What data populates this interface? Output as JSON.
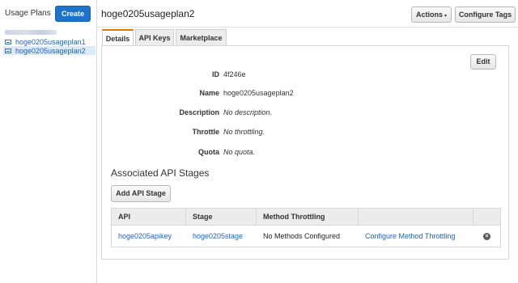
{
  "sidebar": {
    "title": "Usage Plans",
    "create_label": "Create",
    "items": [
      {
        "label": "hoge0205usageplan1",
        "selected": false
      },
      {
        "label": "hoge0205usageplan2",
        "selected": true
      }
    ]
  },
  "header": {
    "title": "hoge0205usageplan2",
    "actions_label": "Actions",
    "configure_tags_label": "Configure Tags"
  },
  "tabs": [
    {
      "label": "Details",
      "active": true
    },
    {
      "label": "API Keys",
      "active": false
    },
    {
      "label": "Marketplace",
      "active": false
    }
  ],
  "details": {
    "edit_label": "Edit",
    "fields": [
      {
        "label": "ID",
        "value": "4f246e",
        "italic": false
      },
      {
        "label": "Name",
        "value": "hoge0205usageplan2",
        "italic": false
      },
      {
        "label": "Description",
        "value": "No description.",
        "italic": true
      },
      {
        "label": "Throttle",
        "value": "No throttling.",
        "italic": true
      },
      {
        "label": "Quota",
        "value": "No quota.",
        "italic": true
      }
    ]
  },
  "stages": {
    "title": "Associated API Stages",
    "add_label": "Add API Stage",
    "columns": [
      "API",
      "Stage",
      "Method Throttling",
      ""
    ],
    "rows": [
      {
        "api": "hoge0205apikey",
        "stage": "hoge0205stage",
        "throttling": "No Methods Configured",
        "action": "Configure Method Throttling"
      }
    ]
  },
  "colors": {
    "primary": "#1e73c8",
    "link": "#1f63b8",
    "tab_accent": "#e07b00"
  },
  "icons": {
    "plan_item": "usage-plan-icon",
    "remove": "remove-circle-icon",
    "actions_caret": "caret-down-icon"
  }
}
